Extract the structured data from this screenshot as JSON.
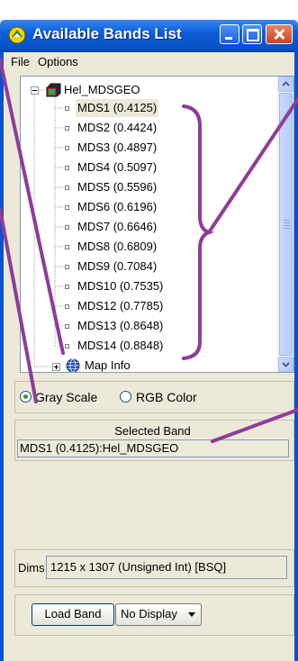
{
  "window": {
    "title": "Available Bands List"
  },
  "menu": {
    "file": "File",
    "options": "Options"
  },
  "tree": {
    "root": "Hel_MDSGEO",
    "bands": [
      "MDS1 (0.4125)",
      "MDS2 (0.4424)",
      "MDS3 (0.4897)",
      "MDS4 (0.5097)",
      "MDS5 (0.5596)",
      "MDS6 (0.6196)",
      "MDS7 (0.6646)",
      "MDS8 (0.6809)",
      "MDS9 (0.7084)",
      "MDS10 (0.7535)",
      "MDS12 (0.7785)",
      "MDS13 (0.8648)",
      "MDS14 (0.8848)"
    ],
    "map_info": "Map Info"
  },
  "mode": {
    "gray": "Gray Scale",
    "rgb": "RGB Color",
    "selected": "gray"
  },
  "selected_band": {
    "title": "Selected Band",
    "value": "MDS1 (0.4125):Hel_MDSGEO"
  },
  "dims": {
    "label": "Dims",
    "value": "1215 x 1307 (Unsigned Int) [BSQ]"
  },
  "buttons": {
    "load_band": "Load Band",
    "display": "No Display"
  },
  "colors": {
    "annotation": "#8e3c9a",
    "titlebar": "#0a5ed9"
  }
}
